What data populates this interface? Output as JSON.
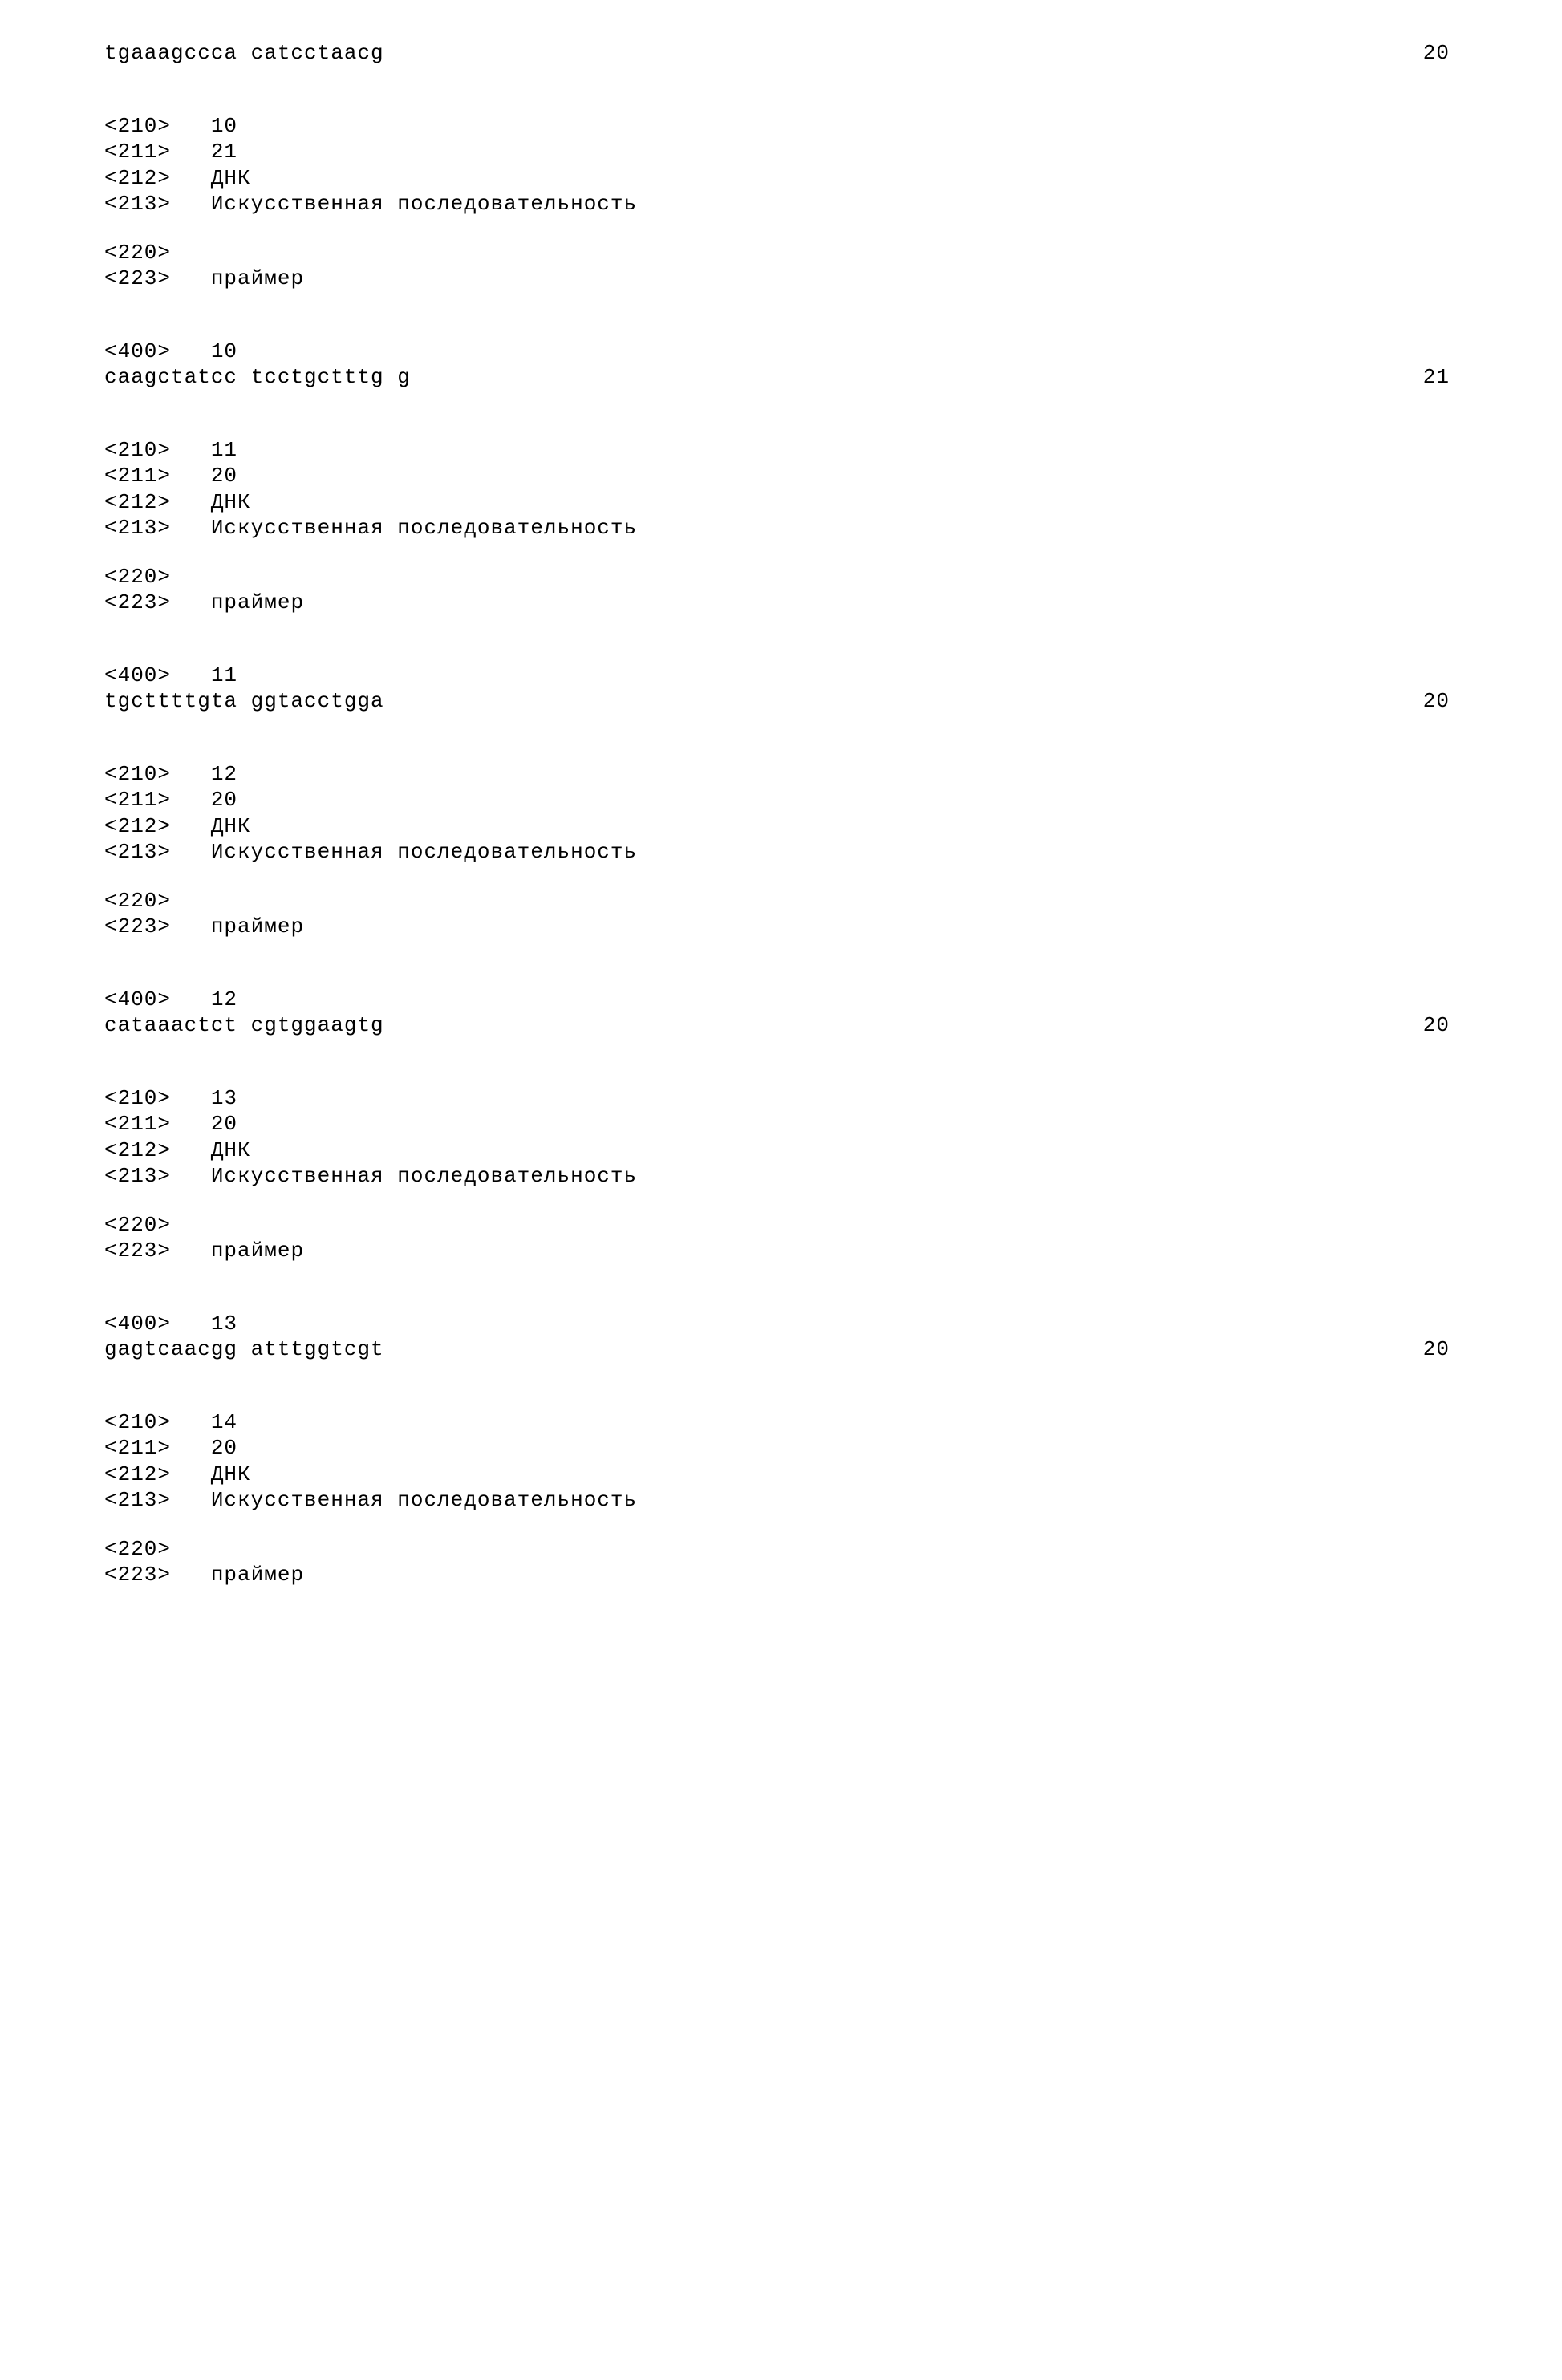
{
  "entries": [
    {
      "sequence": "tgaaagccca catcctaacg",
      "length": "20",
      "meta": null
    },
    {
      "meta": {
        "t210": "10",
        "t211": "21",
        "t212": "ДНК",
        "t213": "Искусственная последовательность",
        "t220": "",
        "t223": "праймер",
        "t400": "10"
      },
      "sequence": "caagctatcc tcctgctttg g",
      "length": "21"
    },
    {
      "meta": {
        "t210": "11",
        "t211": "20",
        "t212": "ДНК",
        "t213": "Искусственная последовательность",
        "t220": "",
        "t223": "праймер",
        "t400": "11"
      },
      "sequence": "tgcttttgta ggtacctgga",
      "length": "20"
    },
    {
      "meta": {
        "t210": "12",
        "t211": "20",
        "t212": "ДНК",
        "t213": "Искусственная последовательность",
        "t220": "",
        "t223": "праймер",
        "t400": "12"
      },
      "sequence": "cataaactct cgtggaagtg",
      "length": "20"
    },
    {
      "meta": {
        "t210": "13",
        "t211": "20",
        "t212": "ДНК",
        "t213": "Искусственная последовательность",
        "t220": "",
        "t223": "праймер",
        "t400": "13"
      },
      "sequence": "gagtcaacgg atttggtcgt",
      "length": "20"
    },
    {
      "meta": {
        "t210": "14",
        "t211": "20",
        "t212": "ДНК",
        "t213": "Искусственная последовательность",
        "t220": "",
        "t223": "праймер"
      },
      "sequence": null,
      "length": null
    }
  ],
  "labels": {
    "t210": "<210>",
    "t211": "<211>",
    "t212": "<212>",
    "t213": "<213>",
    "t220": "<220>",
    "t223": "<223>",
    "t400": "<400>"
  }
}
